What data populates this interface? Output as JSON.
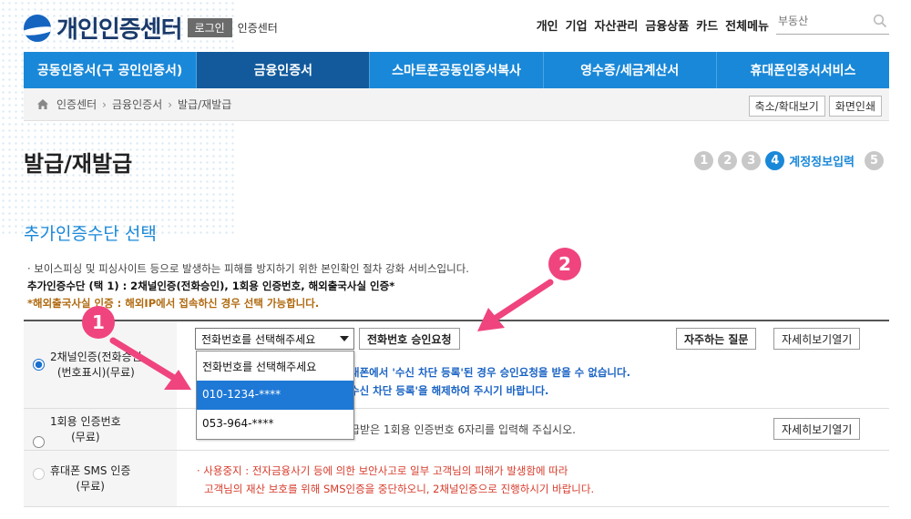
{
  "header": {
    "logo_text": "개인인증센터",
    "login_label": "로그인",
    "cert_label": "인증센터",
    "gnb": [
      "개인",
      "기업",
      "자산관리",
      "금융상품",
      "카드",
      "전체메뉴"
    ],
    "search_placeholder": "부동산"
  },
  "nav": {
    "items": [
      "공동인증서(구 공인인증서)",
      "금융인증서",
      "스마트폰공동인증서복사",
      "영수증/세금계산서",
      "휴대폰인증서서비스"
    ],
    "active_index": 1
  },
  "breadcrumb": {
    "items": [
      "인증센터",
      "금융인증서",
      "발급/재발급"
    ],
    "zoom_label": "축소/확대보기",
    "print_label": "화면인쇄"
  },
  "page": {
    "title": "발급/재발급",
    "steps": [
      "1",
      "2",
      "3",
      "4",
      "5"
    ],
    "active_step": 4,
    "active_step_label": "계정정보입력"
  },
  "section": {
    "title": "추가인증수단 선택",
    "desc1": "· 보이스피싱 및 피싱사이트 등으로 발생하는 피해를 방지하기 위한 본인확인 절차 강화 서비스입니다.",
    "desc2": "추가인증수단 (택 1) : 2채널인증(전화승인), 1회용 인증번호, 해외출국사실 인증*",
    "desc3": "*해외출국사실 인증 : 해외IP에서 접속하신 경우 선택 가능합니다."
  },
  "options": [
    {
      "label_line1": "2채널인증(전화승인",
      "label_line2": "(번호표시)(무료)",
      "selected": true,
      "select_value": "전화번호를 선택해주세요",
      "request_button": "전화번호 승인요청",
      "faq_button": "자주하는 질문",
      "detail_button": "자세히보기열기",
      "note_line1": "대폰에서 '수신 차단 등록'된 경우 승인요청을 받을 수 없습니다.",
      "note_line2": "수신 차단 등록'을 해제하여 주시기 바랍니다."
    },
    {
      "label_line1": "1회용 인증번호",
      "label_line2": "(무료)",
      "selected": false,
      "note": "급받은 1회용 인증번호 6자리를 입력해 주십시오.",
      "detail_button": "자세히보기열기"
    },
    {
      "label_line1": "휴대폰 SMS 인증",
      "label_line2": "(무료)",
      "selected": false,
      "note_line1": "· 사용중지 : 전자금융사기 등에 의한 보안사고로 일부 고객님의 피해가 발생함에 따라",
      "note_line2": "고객님의 재산 보호를 위해 SMS인증을 중단하오니, 2채널인증으로 진행하시기 바랍니다."
    }
  ],
  "dropdown": {
    "options": [
      "전화번호를 선택해주세요",
      "010-1234-****",
      "053-964-****"
    ],
    "highlighted_index": 1
  },
  "annotations": {
    "marker1": "1",
    "marker2": "2",
    "color": "#f0447e"
  }
}
